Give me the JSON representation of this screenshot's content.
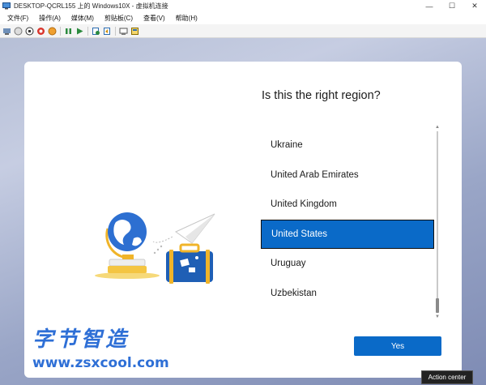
{
  "window": {
    "title": "DESKTOP-QCRL155 上的 Windows10X - 虚拟机连接",
    "minimize": "—",
    "maximize": "☐",
    "close": "✕"
  },
  "menu": [
    "文件(F)",
    "操作(A)",
    "媒体(M)",
    "剪贴板(C)",
    "查看(V)",
    "帮助(H)"
  ],
  "oobe": {
    "heading": "Is this the right region?",
    "regions": [
      "Ukraine",
      "United Arab Emirates",
      "United Kingdom",
      "United States",
      "Uruguay",
      "Uzbekistan"
    ],
    "selected_region": "United States",
    "yes_button": "Yes"
  },
  "watermark": {
    "chinese": "字节智造",
    "url": "www.zsxcool.com"
  },
  "tooltip": "Action center",
  "colors": {
    "accent": "#0a6ac8",
    "watermark": "#2e6fd6"
  }
}
